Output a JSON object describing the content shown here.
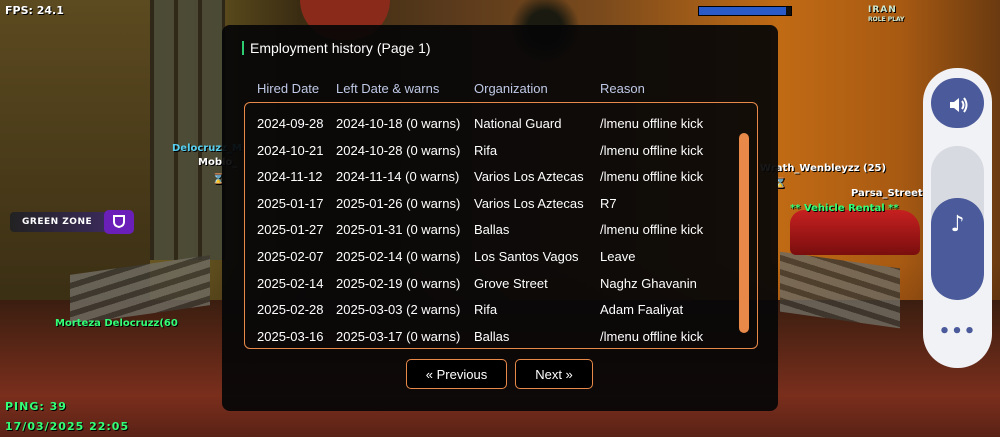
{
  "hud": {
    "fps": "FPS: 24.1",
    "logo_main": "IRAN",
    "logo_sub": "ROLE PLAY",
    "progress": 0.95,
    "ping": "PING: 39",
    "datetime": "17/03/2025 22:05",
    "zone_label": "GREEN ZONE",
    "zone_icon": "shield-icon"
  },
  "world_labels": {
    "player1": "Delocruzz_M",
    "player2": "Moblo_",
    "player3": "Morteza Delocruzz(60",
    "player4": "Wrath_Wenbleyzz (25)",
    "player5": "Parsa_Streetb",
    "vehicle": "** Vehicle Rental **"
  },
  "dialog": {
    "title": "Employment history (Page 1)",
    "columns": [
      "Hired Date",
      "Left Date & warns",
      "Organization",
      "Reason"
    ],
    "rows": [
      [
        "2024-09-28",
        "2024-10-18 (0 warns)",
        "National Guard",
        "/lmenu offline kick"
      ],
      [
        "2024-10-21",
        "2024-10-28 (0 warns)",
        "Rifa",
        "/lmenu offline kick"
      ],
      [
        "2024-11-12",
        "2024-11-14 (0 warns)",
        "Varios Los Aztecas",
        "/lmenu offline kick"
      ],
      [
        "2025-01-17",
        "2025-01-26 (0 warns)",
        "Varios Los Aztecas",
        "R7"
      ],
      [
        "2025-01-27",
        "2025-01-31 (0 warns)",
        "Ballas",
        "/lmenu offline kick"
      ],
      [
        "2025-02-07",
        "2025-02-14 (0 warns)",
        "Los Santos Vagos",
        "Leave"
      ],
      [
        "2025-02-14",
        "2025-02-19 (0 warns)",
        "Grove Street",
        "Naghz Ghavanin"
      ],
      [
        "2025-02-28",
        "2025-03-03 (2 warns)",
        "Rifa",
        "Adam Faaliyat"
      ],
      [
        "2025-03-16",
        "2025-03-17 (0 warns)",
        "Ballas",
        "/lmenu offline kick"
      ]
    ],
    "prev_label": "« Previous",
    "next_label": "Next »"
  },
  "controls": {
    "volume_icon": "speaker-icon",
    "music_icon": "music-note-icon",
    "volume_level": 0.66,
    "more_icon": "more-dots-icon"
  },
  "colors": {
    "accent": "#e8894a",
    "title_marker": "#2ecc71",
    "panel_accent": "#4a5a9a",
    "hud_green": "#33ff77"
  }
}
